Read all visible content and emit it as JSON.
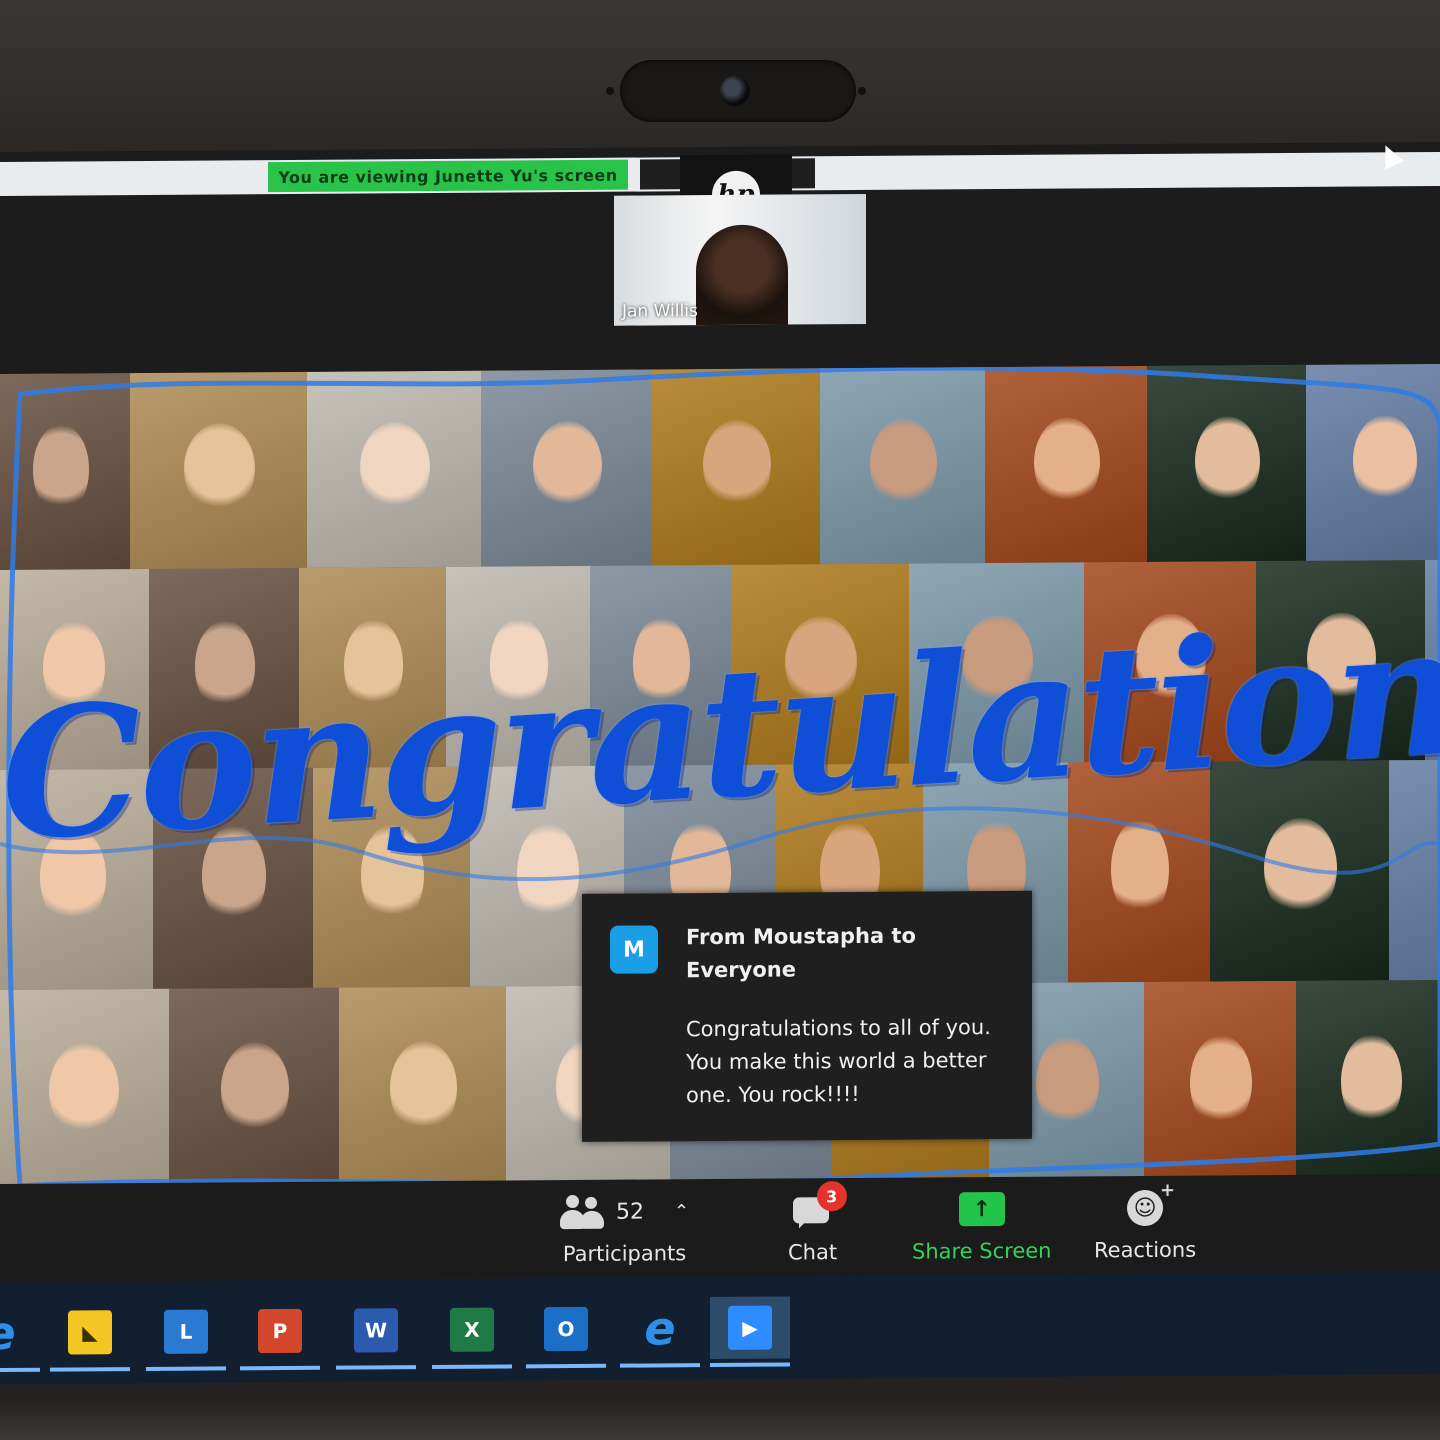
{
  "window": {
    "viewing_banner": "You are viewing Junette Yu's screen",
    "brand_logo": "hp"
  },
  "speaker": {
    "name": "Jan Willis"
  },
  "shared_screen": {
    "headline": "Congratulations"
  },
  "chat_notification": {
    "avatar_initial": "M",
    "sender": "From Moustapha to Everyone",
    "message": "Congratulations to all of you. You make this world a better one. You rock!!!!"
  },
  "toolbar": {
    "participants_count": "52",
    "participants_label": "Participants",
    "chat_badge": "3",
    "chat_label": "Chat",
    "share_label": "Share Screen",
    "reactions_label": "Reactions"
  },
  "taskbar": {
    "apps": [
      "edge-icon",
      "sticky-notes-icon",
      "lync-icon",
      "powerpoint-icon",
      "word-icon",
      "excel-icon",
      "outlook-icon",
      "edge-icon",
      "zoom-icon"
    ]
  },
  "colors": {
    "zoom_green": "#2ac34a",
    "congrats_blue": "#0f4fd8",
    "chat_badge_red": "#e5322c",
    "taskbar_bg": "#121f31"
  }
}
